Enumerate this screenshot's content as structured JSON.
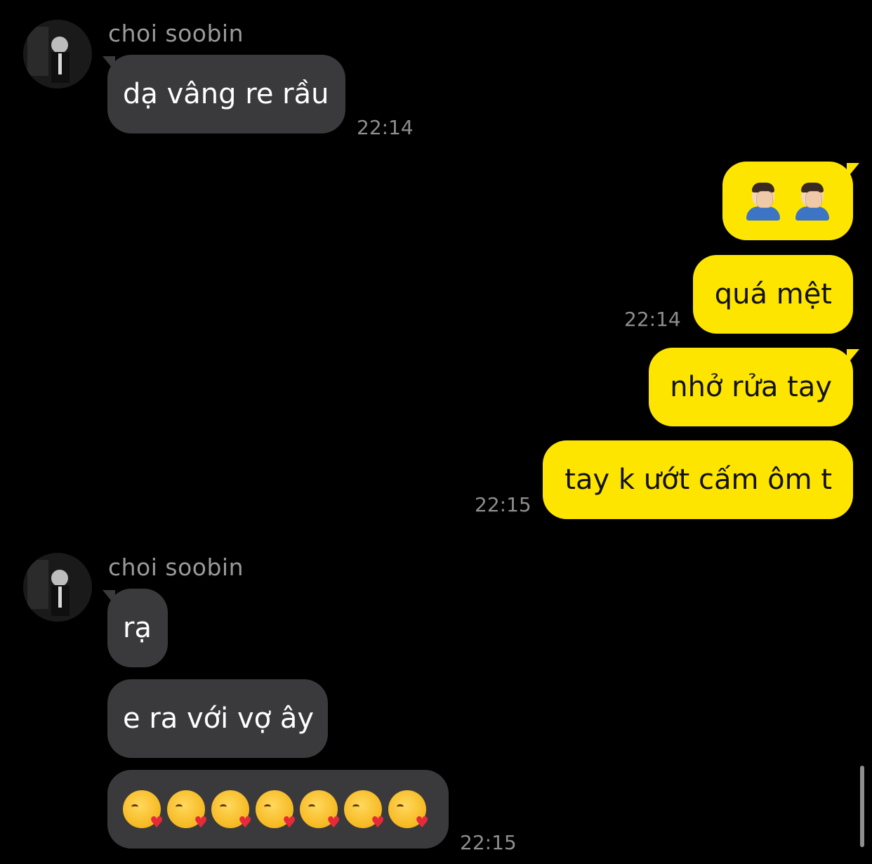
{
  "chat": {
    "groups": [
      {
        "sender": "choi soobin",
        "messages": [
          "dạ vâng re rầu"
        ],
        "time": "22:14"
      },
      {
        "sender": "me",
        "messages": [
          "🤦🏻‍♂️🤦🏻‍♂️",
          "quá mệt"
        ],
        "time": "22:14"
      },
      {
        "sender": "me",
        "messages": [
          "nhở rửa tay",
          "tay k ướt cấm ôm t"
        ],
        "time": "22:15"
      },
      {
        "sender": "choi soobin",
        "messages": [
          "rạ",
          "e ra với vợ ây",
          "😘😘😘😘😘😘😘"
        ],
        "time": "22:15"
      }
    ]
  },
  "icons": {
    "avatar": "avatar-photo",
    "facepalm": "man-facepalming-icon",
    "kiss": "face-blowing-kiss-icon"
  },
  "colors": {
    "background": "#000000",
    "incoming_bubble": "#3a3a3c",
    "outgoing_bubble": "#fee500",
    "timestamp": "#8e8e8e",
    "sender_name": "#9a9a9a"
  }
}
